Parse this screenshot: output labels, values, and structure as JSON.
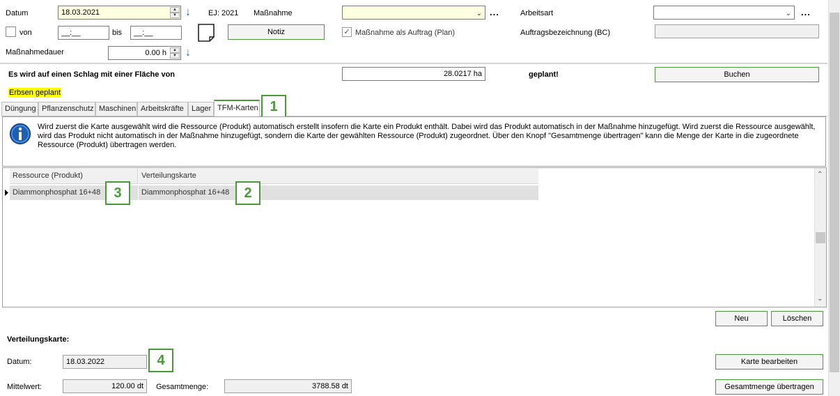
{
  "header": {
    "datum_label": "Datum",
    "datum_value": "18.03.2021",
    "ej_label": "EJ: 2021",
    "massnahme_label": "Maßnahme",
    "massnahme_value": "",
    "arbeitsart_label": "Arbeitsart",
    "arbeitsart_value": "",
    "von_label": "von",
    "von_value": "__:__",
    "bis_label": "bis",
    "bis_value": "__:__",
    "notiz_button": "Notiz",
    "auftrag_checkbox_label": "Maßnahme als Auftrag (Plan)",
    "auftrag_checked": true,
    "auftragsbezeichnung_label": "Auftragsbezeichnung (BC)",
    "auftragsbezeichnung_value": "",
    "dauer_label": "Maßnahmedauer",
    "dauer_value": "0.00 h",
    "more_dots": "..."
  },
  "plan": {
    "prefix_text": "Es wird auf einen Schlag mit einer Fläche von",
    "area_value": "28.0217 ha",
    "suffix_text": "geplant!",
    "buchen_button": "Buchen",
    "highlight_text": "Erbsen geplant",
    "highlight_color": "#ffff00"
  },
  "tabs": [
    {
      "label": "Düngung"
    },
    {
      "label": "Pflanzenschutz"
    },
    {
      "label": "Maschinen"
    },
    {
      "label": "Arbeitskräfte"
    },
    {
      "label": "Lager"
    },
    {
      "label": "TFM-Karten"
    }
  ],
  "active_tab": "TFM-Karten",
  "info": {
    "text": "Wird zuerst die Karte ausgewählt wird die Ressource (Produkt) automatisch erstellt insofern die Karte ein Produkt enthält. Dabei wird das Produkt automatisch in der Maßnahme hinzugefügt. Wird zuerst die Ressource ausgewählt, wird das Produkt nicht automatisch in der Maßnahme hinzugefügt, sondern die Karte der gewählten Ressource (Produkt) zugeordnet. Über den Knopf \"Gesamtmenge übertragen\" kann die Menge der Karte in die zugeordnete Ressource (Produkt) übertragen werden."
  },
  "grid": {
    "columns": [
      "Ressource (Produkt)",
      "Verteilungskarte"
    ],
    "rows": [
      {
        "ressource": "Diammonphosphat 16+48",
        "karte": "Diammonphosphat 16+48"
      }
    ]
  },
  "grid_buttons": {
    "neu": "Neu",
    "loeschen": "Löschen"
  },
  "verteilungskarte": {
    "heading": "Verteilungskarte:",
    "datum_label": "Datum:",
    "datum_value": "18.03.2022",
    "mittelwert_label": "Mittelwert:",
    "mittelwert_value": "120.00 dt",
    "gesamtmenge_label": "Gesamtmenge:",
    "gesamtmenge_value": "3788.58 dt",
    "karte_bearbeiten_button": "Karte bearbeiten",
    "gesamtmenge_button": "Gesamtmenge übertragen"
  },
  "markers": [
    "1",
    "2",
    "3",
    "4"
  ],
  "colors": {
    "accent_green": "#4a9a3a",
    "info_blue": "#1e5fb5",
    "yellow_input": "#ffffe1"
  }
}
